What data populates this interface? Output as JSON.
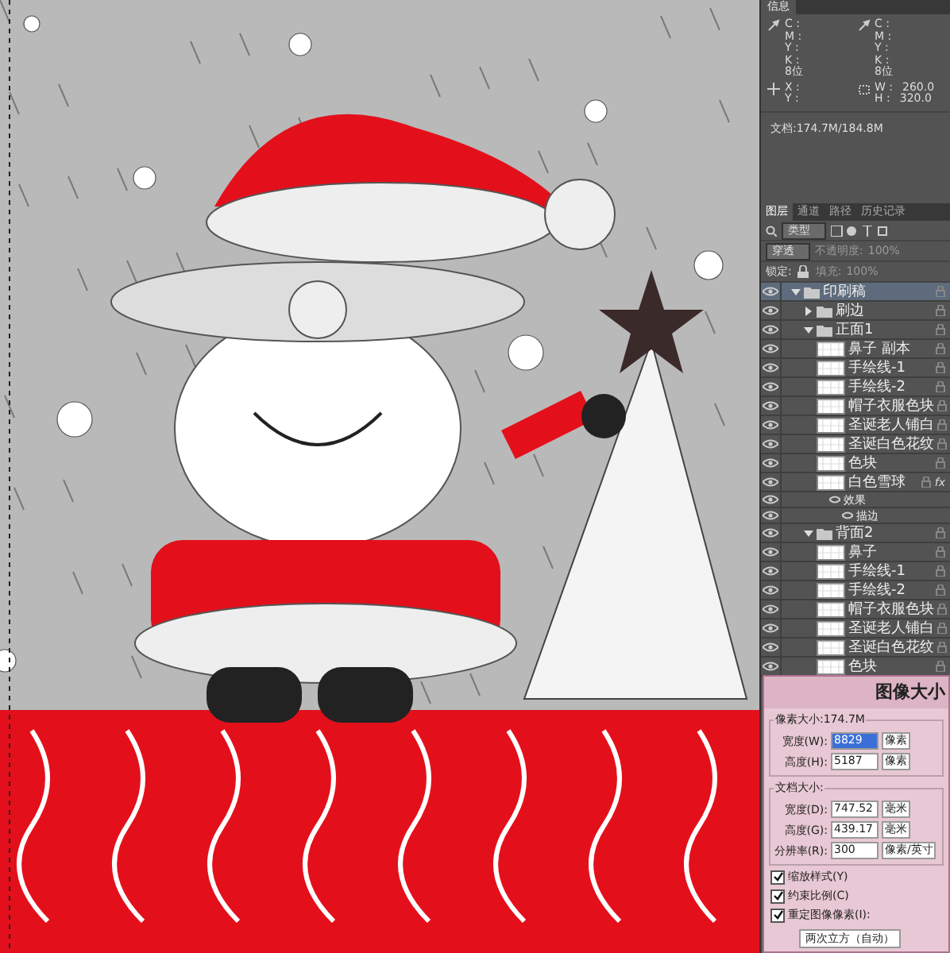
{
  "info_panel": {
    "tab": "信息",
    "left_readouts": [
      "C :",
      "M :",
      "Y :",
      "K :"
    ],
    "left_bits": "8位",
    "right_readouts": [
      "C :",
      "M :",
      "Y :",
      "K :"
    ],
    "right_bits": "8位",
    "position": [
      "X :",
      "Y :"
    ],
    "size": [
      {
        "label": "W :",
        "value": "260.0"
      },
      {
        "label": "H :",
        "value": "320.0"
      }
    ],
    "document": "文档:174.7M/184.8M"
  },
  "layers_panel": {
    "tabs": [
      {
        "label": "图层",
        "selected": true
      },
      {
        "label": "通道",
        "selected": false
      },
      {
        "label": "路径",
        "selected": false
      },
      {
        "label": "历史记录",
        "selected": false
      }
    ],
    "filter": "类型",
    "blend_mode": "穿透",
    "opacity_label": "不透明度:",
    "opacity": "100%",
    "lock_label": "锁定:",
    "fill_label": "填充:",
    "fill": "100%",
    "layers": [
      {
        "name": "印刷稿",
        "kind": "group",
        "visible": true,
        "selected": true,
        "expanded": true,
        "children": [
          {
            "name": "刷边",
            "kind": "group",
            "visible": true,
            "selected": false,
            "expanded": false
          },
          {
            "name": "正面1",
            "kind": "group",
            "visible": true,
            "selected": false,
            "expanded": true,
            "children": [
              {
                "name": "鼻子 副本",
                "kind": "layer",
                "visible": true,
                "selected": false
              },
              {
                "name": "手绘线-1",
                "kind": "layer",
                "visible": true,
                "selected": false
              },
              {
                "name": "手绘线-2",
                "kind": "layer",
                "visible": true,
                "selected": false
              },
              {
                "name": "帽子衣服色块",
                "kind": "layer",
                "visible": true,
                "selected": false
              },
              {
                "name": "圣诞老人铺白",
                "kind": "layer",
                "visible": true,
                "selected": false
              },
              {
                "name": "圣诞白色花纹",
                "kind": "layer",
                "visible": true,
                "selected": false
              },
              {
                "name": "色块",
                "kind": "layer",
                "visible": true,
                "selected": false
              },
              {
                "name": "白色雪球",
                "kind": "layer",
                "visible": true,
                "selected": false,
                "fx": "fx",
                "children": [
                  {
                    "name": "效果",
                    "kind": "effect",
                    "visible": true,
                    "selected": false,
                    "children": [
                      {
                        "name": "描边",
                        "kind": "effect",
                        "visible": true,
                        "selected": false
                      }
                    ]
                  }
                ]
              }
            ]
          },
          {
            "name": "背面2",
            "kind": "group",
            "visible": true,
            "selected": false,
            "expanded": true,
            "children": [
              {
                "name": "鼻子",
                "kind": "layer",
                "visible": true,
                "selected": false
              },
              {
                "name": "手绘线-1",
                "kind": "layer",
                "visible": true,
                "selected": false
              },
              {
                "name": "手绘线-2",
                "kind": "layer",
                "visible": true,
                "selected": false
              },
              {
                "name": "帽子衣服色块",
                "kind": "layer",
                "visible": true,
                "selected": false
              },
              {
                "name": "圣诞老人铺白",
                "kind": "layer",
                "visible": true,
                "selected": false
              },
              {
                "name": "圣诞白色花纹",
                "kind": "layer",
                "visible": true,
                "selected": false
              },
              {
                "name": "色块",
                "kind": "layer",
                "visible": true,
                "selected": false
              }
            ]
          }
        ]
      }
    ]
  },
  "image_size_dialog": {
    "title": "图像大小",
    "pixel_dimensions": "像素大小:174.7M",
    "pixel_fields": [
      {
        "label": "宽度(W):",
        "value": "8829",
        "unit": "像素",
        "selected_text": true
      },
      {
        "label": "高度(H):",
        "value": "5187",
        "unit": "像素",
        "selected_text": false
      }
    ],
    "document_size": "文档大小:",
    "document_fields": [
      {
        "label": "宽度(D):",
        "value": "747.52",
        "unit": "毫米"
      },
      {
        "label": "高度(G):",
        "value": "439.17",
        "unit": "毫米"
      },
      {
        "label": "分辨率(R):",
        "value": "300",
        "unit": "像素/英寸"
      }
    ],
    "options": [
      {
        "label": "缩放样式(Y)",
        "checked": true
      },
      {
        "label": "约束比例(C)",
        "checked": true
      },
      {
        "label": "重定图像像素(I):",
        "checked": true
      }
    ],
    "resample": "两次立方（自动）"
  }
}
